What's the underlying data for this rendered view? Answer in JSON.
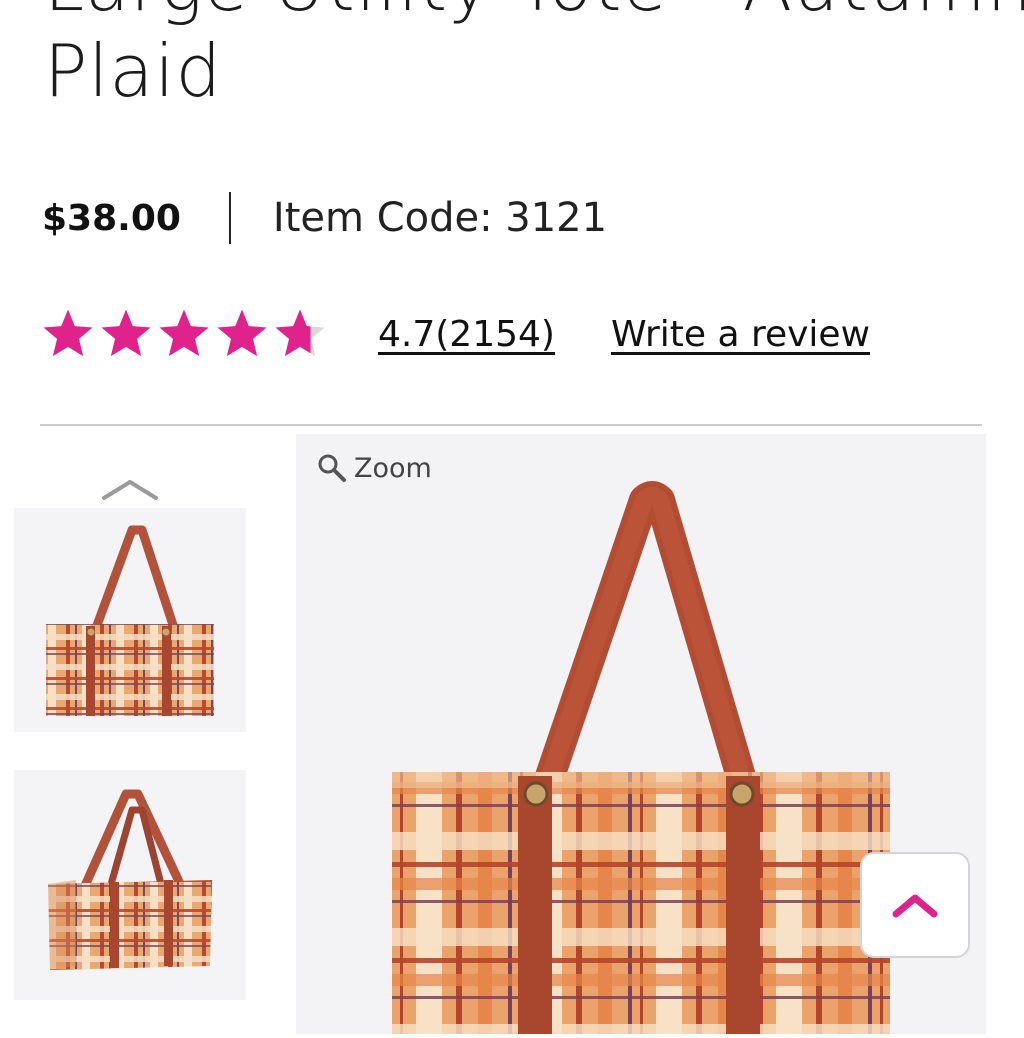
{
  "product": {
    "title_line1": "Large Utility Tote - Autumn",
    "title_line2": "Plaid",
    "price": "$38.00",
    "item_code": "Item Code: 3121"
  },
  "rating": {
    "value": 4.7,
    "max": 5,
    "link_text": "4.7(2154)",
    "write_review": "Write a review",
    "star_color": "#e0228c"
  },
  "gallery": {
    "zoom_label": "Zoom",
    "thumbnails": [
      "thumbnail-tote-front",
      "thumbnail-tote-angle"
    ],
    "prev_icon": "chevron-up-icon"
  },
  "scroll_top": {
    "icon": "chevron-up-icon",
    "color": "#e0228c"
  }
}
